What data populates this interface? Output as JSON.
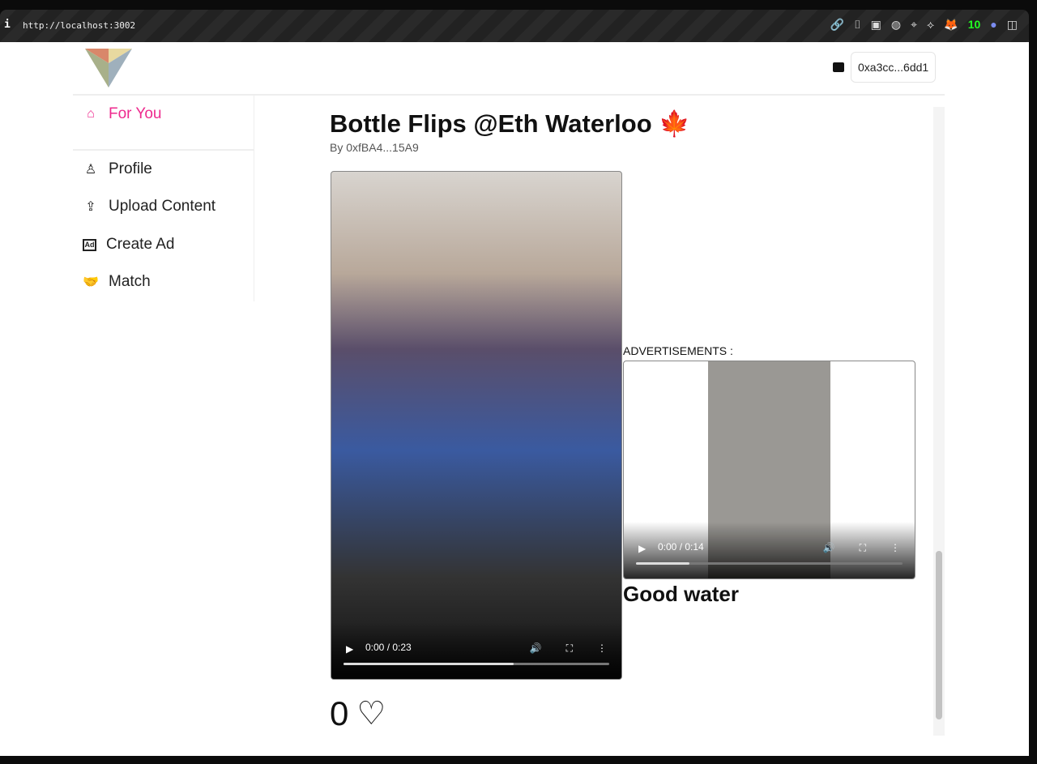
{
  "browser": {
    "url": "http://localhost:3002",
    "badge": "10"
  },
  "header": {
    "wallet_address": "0xa3cc...6dd1"
  },
  "sidebar": {
    "items": [
      {
        "label": "For You",
        "icon": "home-icon",
        "active": true
      },
      {
        "label": "Profile",
        "icon": "user-icon"
      },
      {
        "label": "Upload Content",
        "icon": "upload-icon"
      },
      {
        "label": "Create Ad",
        "icon": "ad-icon"
      },
      {
        "label": "Match",
        "icon": "handshake-icon"
      }
    ]
  },
  "post": {
    "title": "Bottle Flips @Eth Waterloo 🍁",
    "author": "By 0xfBA4...15A9",
    "video": {
      "time": "0:00 / 0:23",
      "buffered": 0.64
    },
    "likes": "0"
  },
  "ads": {
    "label": "ADVERTISEMENTS :",
    "video": {
      "time": "0:00 / 0:14",
      "buffered": 0.2
    },
    "title": "Good water"
  },
  "colors": {
    "accent": "#ee2a8e"
  }
}
